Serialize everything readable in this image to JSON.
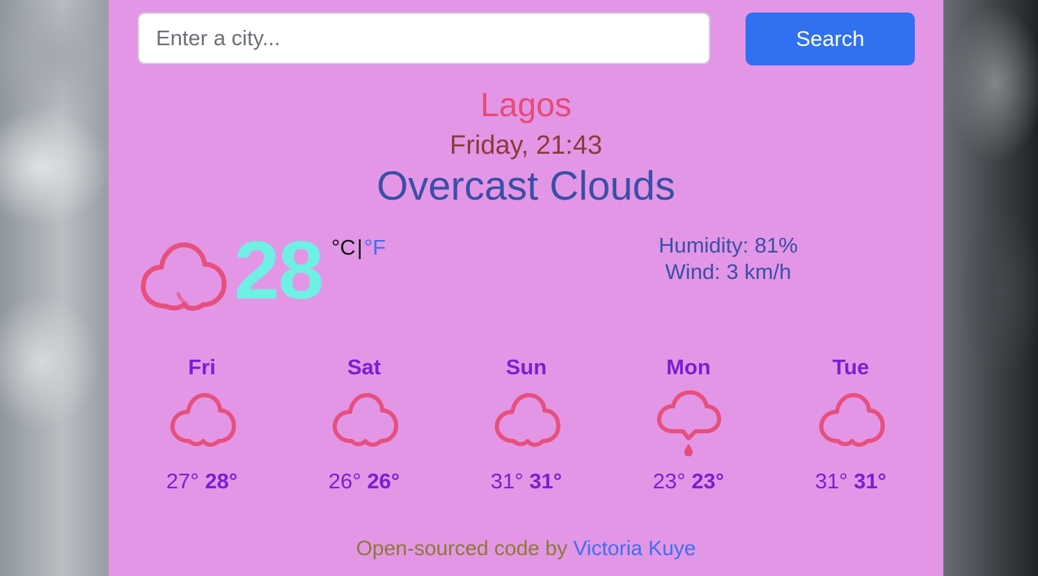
{
  "search": {
    "placeholder": "Enter a city...",
    "button_label": "Search"
  },
  "current": {
    "city": "Lagos",
    "datetime": "Friday, 21:43",
    "description": "Overcast Clouds",
    "icon": "cloud-icon",
    "temperature": "28",
    "unit_c": "°C",
    "unit_separator": "|",
    "unit_f": "°F",
    "humidity": "Humidity: 81%",
    "wind": "Wind: 3 km/h"
  },
  "forecast": [
    {
      "day": "Fri",
      "icon": "cloud-icon",
      "min": "27°",
      "max": "28°"
    },
    {
      "day": "Sat",
      "icon": "cloud-icon",
      "min": "26°",
      "max": "26°"
    },
    {
      "day": "Sun",
      "icon": "cloud-icon",
      "min": "31°",
      "max": "31°"
    },
    {
      "day": "Mon",
      "icon": "rain-cloud-icon",
      "min": "23°",
      "max": "23°"
    },
    {
      "day": "Tue",
      "icon": "cloud-icon",
      "min": "31°",
      "max": "31°"
    }
  ],
  "footer": {
    "text": "Open-sourced code by",
    "link_label": "Victoria Kuye"
  },
  "colors": {
    "card_background": "#e396e6",
    "accent_button": "#3071f1",
    "city": "#e64a76",
    "temperature": "#6ef0e4",
    "icon_stroke": "#e64a76",
    "forecast_text": "#7a1fd0"
  }
}
